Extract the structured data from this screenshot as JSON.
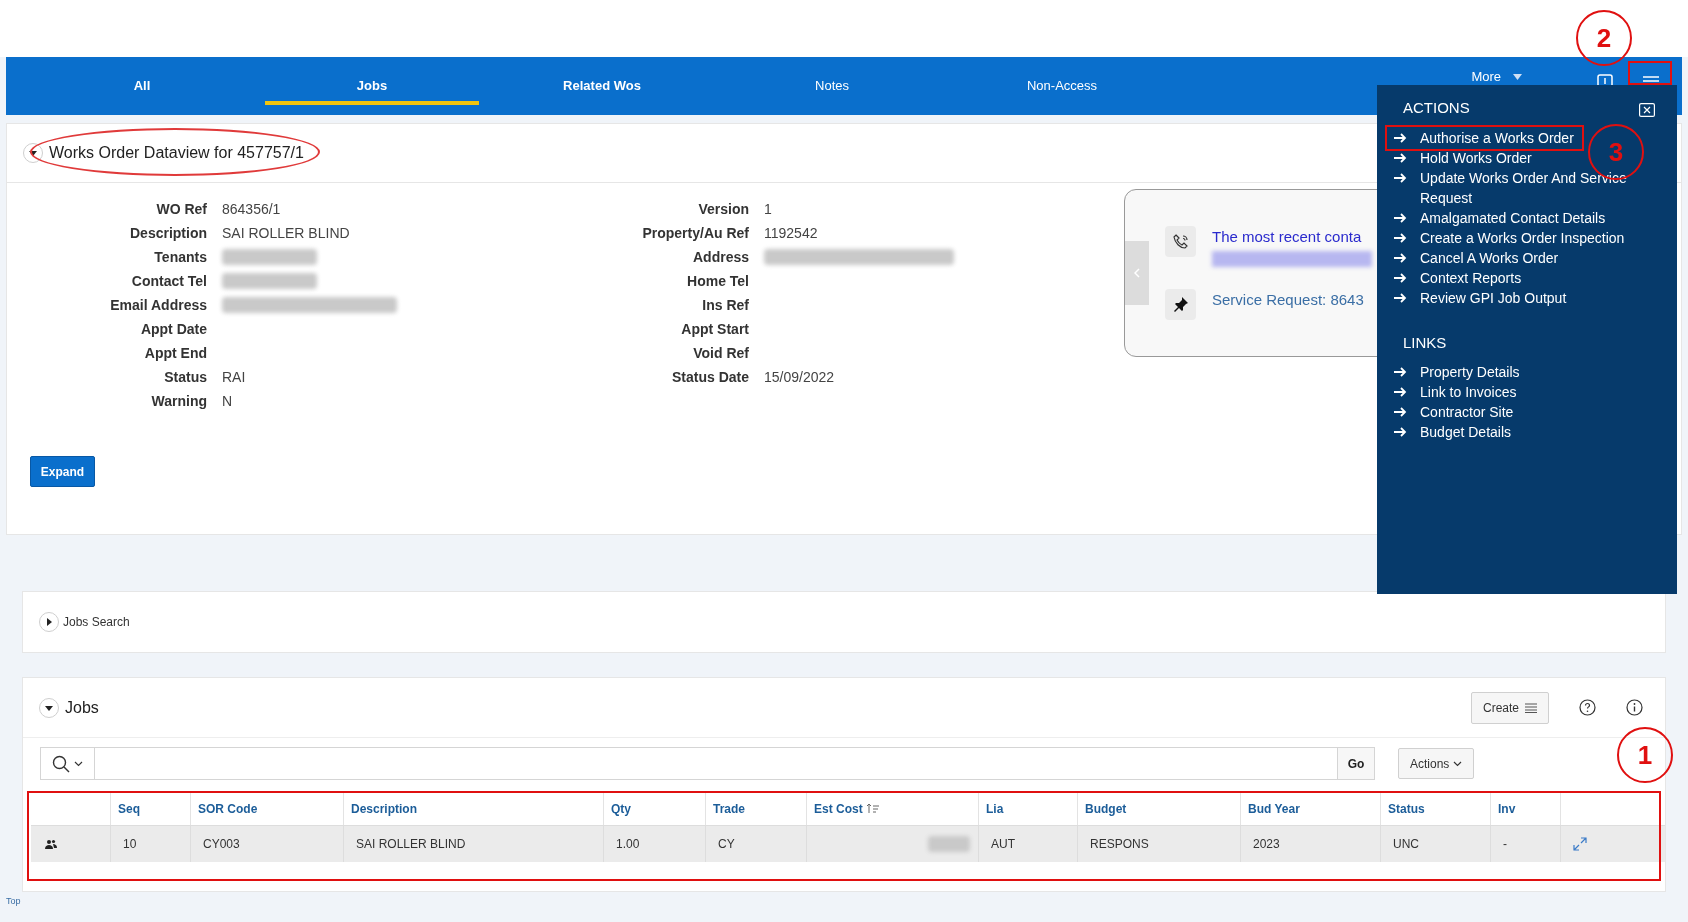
{
  "tabs": [
    {
      "label": "All",
      "selected": false,
      "bold": true
    },
    {
      "label": "Jobs",
      "selected": true,
      "bold": true
    },
    {
      "label": "Related Wos",
      "selected": false,
      "bold": true
    },
    {
      "label": "Notes",
      "selected": false,
      "bold": false
    },
    {
      "label": "Non-Access",
      "selected": false,
      "bold": false
    }
  ],
  "more_tab": {
    "label": "More"
  },
  "dataview": {
    "title": "Works Order Dataview for 457757/1",
    "expanded": true,
    "fields_left": [
      {
        "label": "WO Ref",
        "value": "864356/1"
      },
      {
        "label": "Description",
        "value": "SAI ROLLER BLIND"
      },
      {
        "label": "Tenants",
        "redacted": true
      },
      {
        "label": "Contact Tel",
        "redacted": true
      },
      {
        "label": "Email Address",
        "redacted": true
      },
      {
        "label": "Appt Date"
      },
      {
        "label": "Appt End"
      },
      {
        "label": "Status",
        "value": "RAI"
      },
      {
        "label": "Warning",
        "value": "N"
      }
    ],
    "fields_right": [
      {
        "label": "Version",
        "value": "1"
      },
      {
        "label": "Property/Au Ref",
        "value": "1192542"
      },
      {
        "label": "Address",
        "redacted": true
      },
      {
        "label": "Home Tel"
      },
      {
        "label": "Ins Ref"
      },
      {
        "label": "Appt Start"
      },
      {
        "label": "Void Ref"
      },
      {
        "label": "Status Date",
        "value": "15/09/2022"
      }
    ],
    "expand_button": "Expand"
  },
  "recent_card": {
    "items": [
      {
        "kind": "phone",
        "text": "The most recent conta",
        "redacted_line": true
      },
      {
        "kind": "pin",
        "text": "Service Request: 8643"
      }
    ]
  },
  "menu": {
    "sections": [
      {
        "title": "ACTIONS",
        "items": [
          {
            "label": "Authorise a Works Order",
            "highlighted": true
          },
          {
            "label": "Hold Works Order",
            "highlighted": false
          },
          {
            "label": "Update Works Order And Service Request",
            "highlighted": false
          },
          {
            "label": "Amalgamated Contact Details",
            "highlighted": false
          },
          {
            "label": "Create a Works Order Inspection",
            "highlighted": false
          },
          {
            "label": "Cancel A Works Order",
            "highlighted": false
          },
          {
            "label": "Context Reports",
            "highlighted": false
          },
          {
            "label": "Review GPI Job Output",
            "highlighted": false
          }
        ]
      },
      {
        "title": "LINKS",
        "items": [
          {
            "label": "Property Details",
            "highlighted": false
          },
          {
            "label": "Link to Invoices",
            "highlighted": false
          },
          {
            "label": "Contractor Site",
            "highlighted": false
          },
          {
            "label": "Budget Details",
            "highlighted": false
          }
        ]
      }
    ]
  },
  "jobs_search": {
    "title": "Jobs Search",
    "expanded": false
  },
  "jobs": {
    "title": "Jobs",
    "expanded": true,
    "create_button": "Create",
    "go_button": "Go",
    "actions_button": "Actions",
    "table": {
      "columns": [
        {
          "label": "Seq"
        },
        {
          "label": "SOR Code"
        },
        {
          "label": "Description"
        },
        {
          "label": "Qty"
        },
        {
          "label": "Trade"
        },
        {
          "label": "Est Cost",
          "sorted": true
        },
        {
          "label": "Lia"
        },
        {
          "label": "Budget"
        },
        {
          "label": "Bud Year"
        },
        {
          "label": "Status"
        },
        {
          "label": "Inv"
        }
      ],
      "rows": [
        {
          "cells": [
            {
              "text": "10"
            },
            {
              "text": "CY003"
            },
            {
              "text": "SAI ROLLER BLIND"
            },
            {
              "text": "1.00"
            },
            {
              "text": "CY"
            },
            {
              "redacted": true
            },
            {
              "text": "AUT"
            },
            {
              "text": "RESPONS"
            },
            {
              "text": "2023"
            },
            {
              "text": "UNC"
            },
            {
              "text": "-"
            }
          ]
        }
      ]
    }
  },
  "footer_link": "Top",
  "annotations": [
    {
      "label": "2"
    },
    {
      "label": "3"
    },
    {
      "label": "1"
    }
  ]
}
